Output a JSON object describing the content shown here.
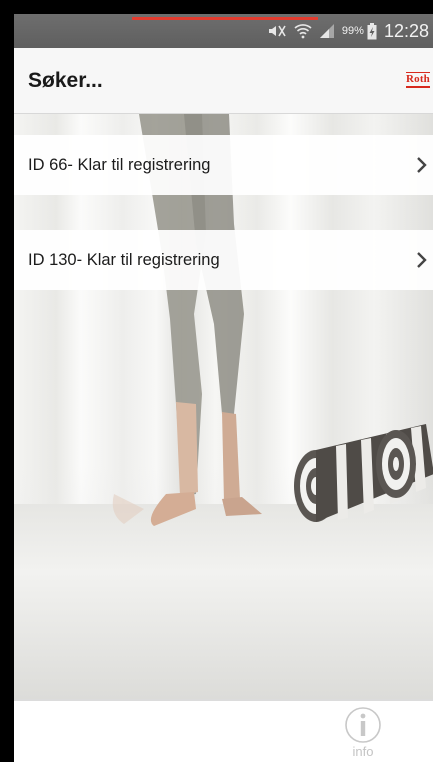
{
  "status_bar": {
    "battery_percent": "99%",
    "time": "12:28",
    "icons": [
      "mute-icon",
      "wifi-icon",
      "signal-icon",
      "battery-charging-icon"
    ]
  },
  "app_bar": {
    "title": "Søker...",
    "logo_text": "Roth",
    "logo_color": "#d72a1e"
  },
  "progress": {
    "color": "#e23b2e"
  },
  "list": {
    "items": [
      {
        "label": "ID 66- Klar til registrering",
        "icon": "chevron-right-icon"
      },
      {
        "label": "ID 130- Klar til registrering",
        "icon": "chevron-right-icon"
      }
    ]
  },
  "bottom_bar": {
    "info_label": "info",
    "info_icon": "info-circle-icon"
  }
}
